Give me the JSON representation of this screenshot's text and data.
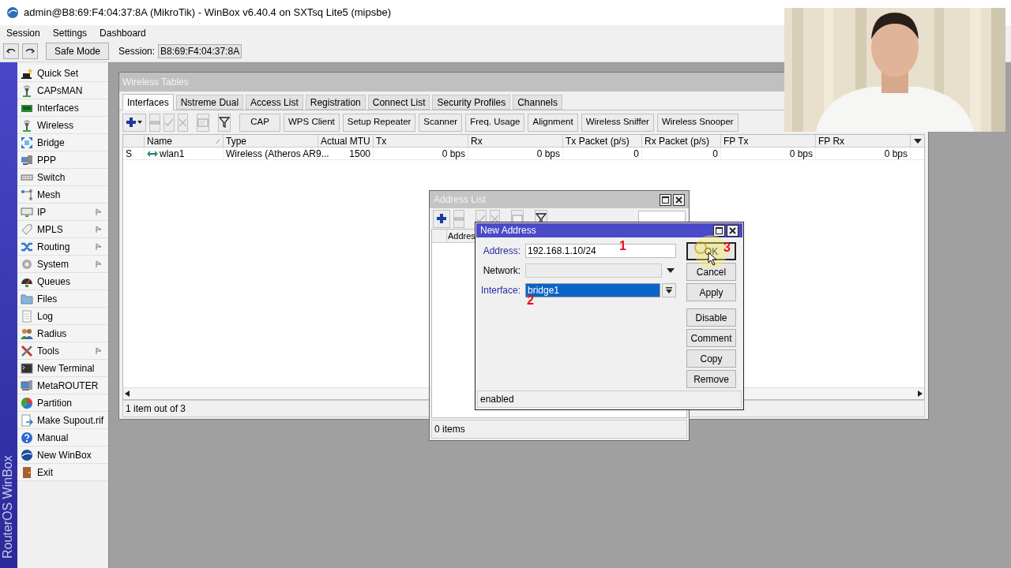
{
  "window": {
    "title": "admin@B8:69:F4:04:37:8A (MikroTik) - WinBox v6.40.4 on SXTsq Lite5 (mipsbe)"
  },
  "menu": [
    "Session",
    "Settings",
    "Dashboard"
  ],
  "toolbar": {
    "safe_mode": "Safe Mode",
    "session_label": "Session:",
    "session_value": "B8:69:F4:04:37:8A"
  },
  "sidebar": {
    "brand": "RouterOS WinBox",
    "items": [
      {
        "label": "Quick Set",
        "has_submenu": false
      },
      {
        "label": "CAPsMAN",
        "has_submenu": false
      },
      {
        "label": "Interfaces",
        "has_submenu": false
      },
      {
        "label": "Wireless",
        "has_submenu": false
      },
      {
        "label": "Bridge",
        "has_submenu": false
      },
      {
        "label": "PPP",
        "has_submenu": false
      },
      {
        "label": "Switch",
        "has_submenu": false
      },
      {
        "label": "Mesh",
        "has_submenu": false
      },
      {
        "label": "IP",
        "has_submenu": true
      },
      {
        "label": "MPLS",
        "has_submenu": true
      },
      {
        "label": "Routing",
        "has_submenu": true
      },
      {
        "label": "System",
        "has_submenu": true
      },
      {
        "label": "Queues",
        "has_submenu": false
      },
      {
        "label": "Files",
        "has_submenu": false
      },
      {
        "label": "Log",
        "has_submenu": false
      },
      {
        "label": "Radius",
        "has_submenu": false
      },
      {
        "label": "Tools",
        "has_submenu": true
      },
      {
        "label": "New Terminal",
        "has_submenu": false
      },
      {
        "label": "MetaROUTER",
        "has_submenu": false
      },
      {
        "label": "Partition",
        "has_submenu": false
      },
      {
        "label": "Make Supout.rif",
        "has_submenu": false
      },
      {
        "label": "Manual",
        "has_submenu": false
      },
      {
        "label": "New WinBox",
        "has_submenu": false
      },
      {
        "label": "Exit",
        "has_submenu": false
      }
    ]
  },
  "wireless_tables": {
    "title": "Wireless Tables",
    "tabs": [
      {
        "label": "Interfaces",
        "selected": true
      },
      {
        "label": "Nstreme Dual",
        "selected": false
      },
      {
        "label": "Access List",
        "selected": false
      },
      {
        "label": "Registration",
        "selected": false
      },
      {
        "label": "Connect List",
        "selected": false
      },
      {
        "label": "Security Profiles",
        "selected": false
      },
      {
        "label": "Channels",
        "selected": false
      }
    ],
    "toolbar_buttons": [
      "CAP",
      "WPS Client",
      "Setup Repeater",
      "Scanner",
      "Freq. Usage",
      "Alignment",
      "Wireless Sniffer",
      "Wireless Snooper"
    ],
    "columns": [
      {},
      {
        "label": "Name"
      },
      {
        "label": "Type"
      },
      {
        "label": "Actual MTU"
      },
      {
        "label": "Tx"
      },
      {
        "label": "Rx"
      },
      {
        "label": "Tx Packet (p/s)"
      },
      {
        "label": "Rx Packet (p/s)"
      },
      {
        "label": "FP Tx"
      },
      {
        "label": "FP Rx"
      }
    ],
    "rows": [
      {
        "cells": [
          "S",
          "wlan1",
          "Wireless (Atheros AR9...",
          "1500",
          "0 bps",
          "0 bps",
          "0",
          "0",
          "0 bps",
          "0 bps"
        ]
      }
    ],
    "status": "1 item out of 3"
  },
  "address_list": {
    "title": "Address List",
    "column": "Addres",
    "status": "0 items"
  },
  "new_address": {
    "title": "New Address",
    "fields": [
      {
        "label": "Address:",
        "value": "192.168.1.10/24",
        "kind": "text",
        "modified": true
      },
      {
        "label": "Network:",
        "kind": "dropdown",
        "modified": false
      },
      {
        "label": "Interface:",
        "value": "bridge1",
        "kind": "select",
        "modified": true,
        "value_selected": true
      }
    ],
    "buttons": [
      {
        "label": "OK",
        "focused": true,
        "separated": false
      },
      {
        "label": "Cancel",
        "focused": false,
        "separated": false
      },
      {
        "label": "Apply",
        "focused": false,
        "separated": false
      },
      {
        "label": "Disable",
        "focused": false,
        "separated": true
      },
      {
        "label": "Comment",
        "focused": false,
        "separated": false
      },
      {
        "label": "Copy",
        "focused": false,
        "separated": false
      },
      {
        "label": "Remove",
        "focused": false,
        "separated": false
      }
    ],
    "status": "enabled"
  },
  "annotations": [
    {
      "text": "1"
    },
    {
      "text": "2"
    },
    {
      "text": "3"
    }
  ]
}
